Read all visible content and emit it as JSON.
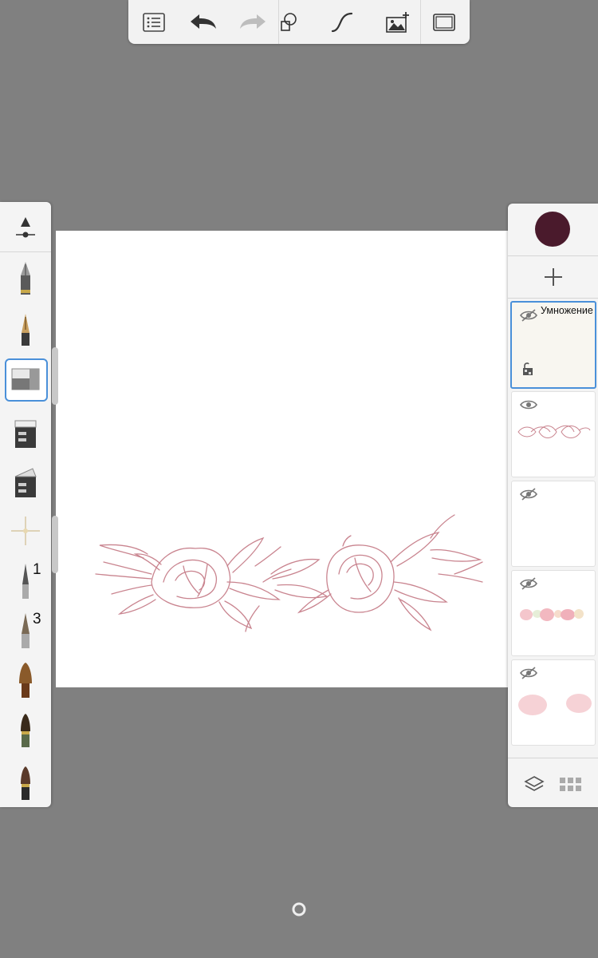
{
  "toolbar": {
    "buttons": [
      {
        "name": "layers-list-icon"
      },
      {
        "name": "undo-icon"
      },
      {
        "name": "redo-icon"
      },
      {
        "name": "shapes-icon"
      },
      {
        "name": "stroke-icon"
      },
      {
        "name": "add-image-icon"
      },
      {
        "name": "fullscreen-icon"
      }
    ]
  },
  "brush_panel": {
    "brushes": [
      {
        "name": "pencil-brush"
      },
      {
        "name": "ink-pen-brush"
      },
      {
        "name": "eraser-brush",
        "selected": true
      },
      {
        "name": "marker-brush"
      },
      {
        "name": "chisel-marker-brush"
      },
      {
        "name": "airbrush-brush"
      },
      {
        "name": "paint-brush-1",
        "number": "1"
      },
      {
        "name": "paint-brush-3",
        "number": "3"
      },
      {
        "name": "flat-brush"
      },
      {
        "name": "watercolor-brush"
      },
      {
        "name": "round-brush"
      }
    ]
  },
  "layers": {
    "active_color": "#4a1a2c",
    "items": [
      {
        "blend": "Умножение",
        "visible": false,
        "locked": true,
        "selected": true
      },
      {
        "blend": "",
        "visible": true,
        "content": "floral-sketch"
      },
      {
        "blend": "",
        "visible": false,
        "content": "empty"
      },
      {
        "blend": "",
        "visible": false,
        "content": "watercolor-flowers"
      },
      {
        "blend": "",
        "visible": false,
        "content": "pink-blobs"
      }
    ]
  },
  "colors": {
    "background": "#808080",
    "accent": "#4a90d9",
    "sketch": "#c9848f"
  }
}
